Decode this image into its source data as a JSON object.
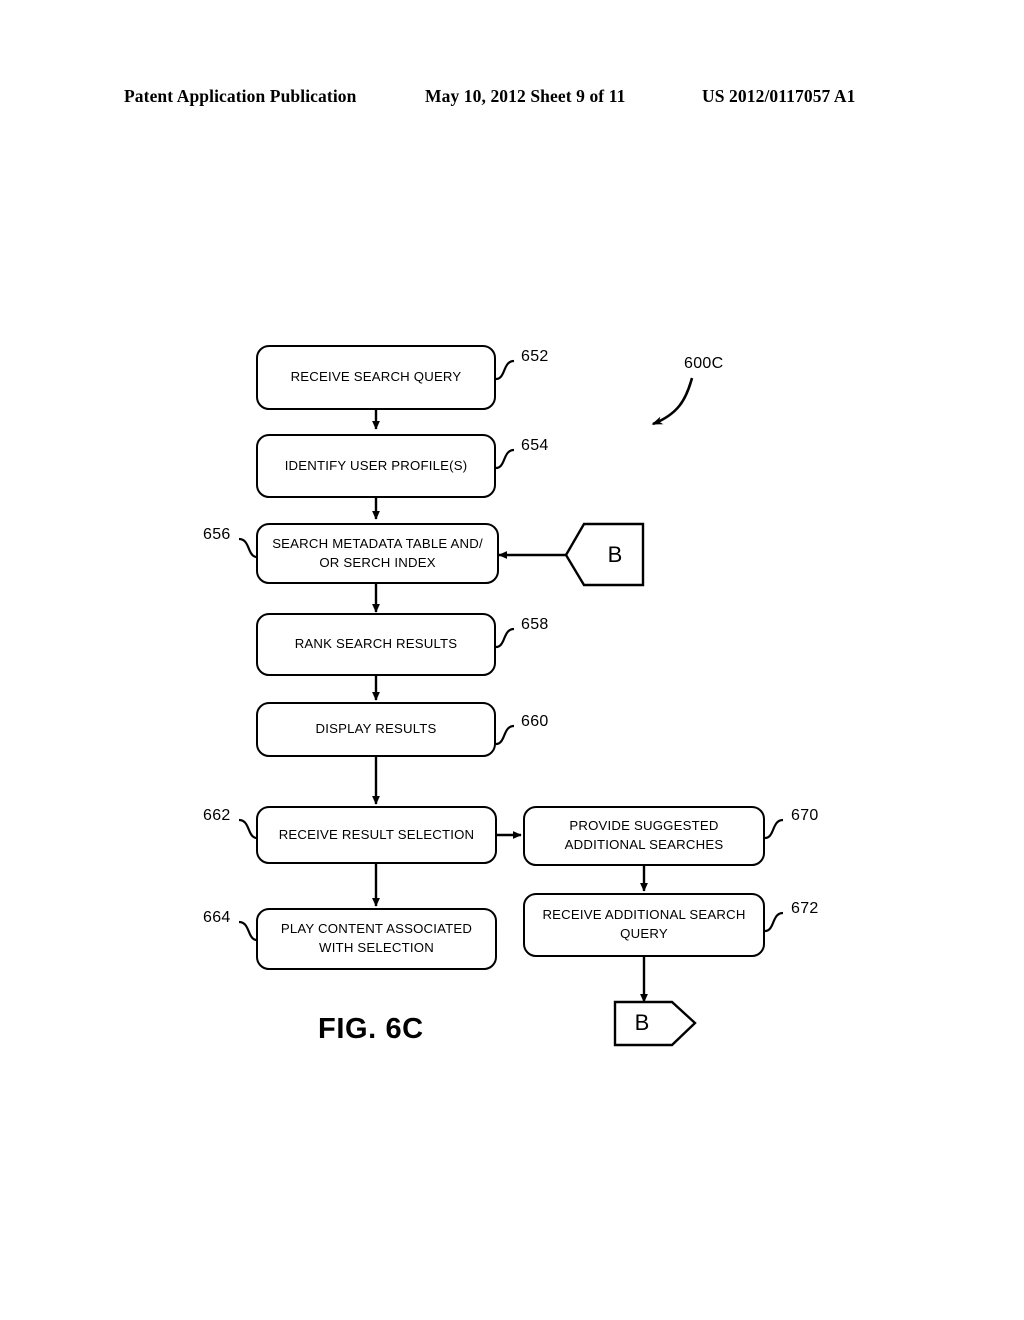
{
  "header": {
    "left": "Patent Application Publication",
    "middle": "May 10, 2012  Sheet 9 of 11",
    "right": "US 2012/0117057 A1"
  },
  "figure": {
    "caption": "FIG. 6C",
    "identifier": "600C",
    "boxes": [
      {
        "ref": "652",
        "text": "RECEIVE SEARCH QUERY"
      },
      {
        "ref": "654",
        "text": "IDENTIFY USER PROFILE(S)"
      },
      {
        "ref": "656",
        "text": "SEARCH METADATA TABLE AND/ OR SERCH INDEX"
      },
      {
        "ref": "658",
        "text": "RANK SEARCH RESULTS"
      },
      {
        "ref": "660",
        "text": "DISPLAY RESULTS"
      },
      {
        "ref": "662",
        "text": "RECEIVE RESULT SELECTION"
      },
      {
        "ref": "664",
        "text": "PLAY CONTENT ASSOCIATED WITH SELECTION"
      },
      {
        "ref": "670",
        "text": "PROVIDE SUGGESTED ADDITIONAL SEARCHES"
      },
      {
        "ref": "672",
        "text": "RECEIVE ADDITIONAL SEARCH QUERY"
      }
    ],
    "connectors": [
      {
        "id": "top",
        "label": "B"
      },
      {
        "id": "bottom",
        "label": "B"
      }
    ]
  }
}
